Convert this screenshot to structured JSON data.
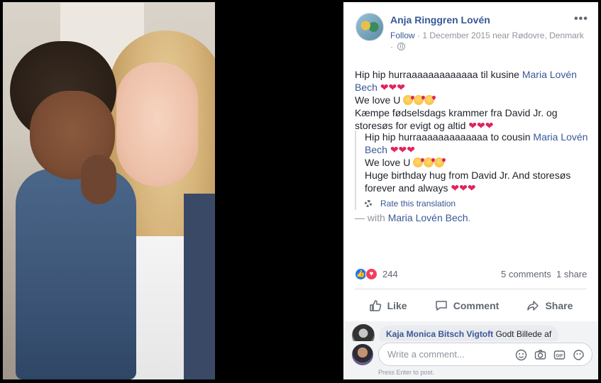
{
  "post": {
    "author": "Anja Ringgren Lovén",
    "follow_label": "Follow",
    "meta_text": "· 1 December 2015 near Rødovre, Denmark",
    "meta_suffix": "·",
    "more_label": "•••",
    "text_line1_prefix": "Hip hip hurraaaaaaaaaaaaa til kusine ",
    "text_line1_link": "Maria Lovén Bech",
    "text_line2": "We love U ",
    "text_line3": "Kæmpe fødselsdags krammer fra David Jr. og storesøs for evigt og altid ",
    "translation": {
      "line1_prefix": "Hip hip hurraaaaaaaaaaaaa to cousin ",
      "line1_link": "Maria Lovén Bech",
      "line2": "We love U ",
      "line3": "Huge birthday hug from David Jr. And storesøs forever and always ",
      "rate_label": "Rate this translation"
    },
    "with_prefix": "— with ",
    "with_link": "Maria Lovén Bech",
    "with_suffix": "."
  },
  "stats": {
    "reactions_count": "244",
    "comments_label": "5 comments",
    "shares_label": "1 share"
  },
  "actions": {
    "like": "Like",
    "comment": "Comment",
    "share": "Share"
  },
  "comments": {
    "preview_name": "Kaja Monica Bitsch Vigtoft",
    "preview_text": " Godt Billede af",
    "placeholder": "Write a comment...",
    "hint": "Press Enter to post."
  },
  "icons": {
    "like_reaction": "like-reaction-icon",
    "love_reaction": "love-reaction-icon",
    "globe": "globe-icon",
    "gear": "gear-icon"
  },
  "colors": {
    "link": "#385898",
    "secondary_text": "#90949c",
    "heart": "#e0245e"
  }
}
